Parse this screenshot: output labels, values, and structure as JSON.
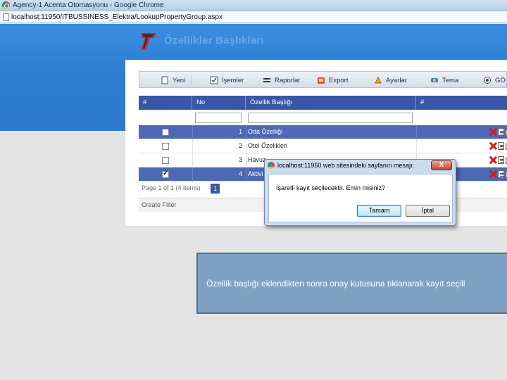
{
  "browser": {
    "window_title": "Agency-1 Acenta Otomasyonu - Google Chrome",
    "url": "localhost:11950/ITBUSSINESS_Elektra/LookupPropertyGroup.aspx"
  },
  "page": {
    "title": "Özellikler Başlıkları"
  },
  "toolbar": {
    "items": [
      {
        "label": "Yeni",
        "icon": "new-document-icon"
      },
      {
        "label": "İşemler",
        "icon": "checklist-icon"
      },
      {
        "label": "Raporlar",
        "icon": "report-icon"
      },
      {
        "label": "Export",
        "icon": "export-icon"
      },
      {
        "label": "Ayarlar",
        "icon": "settings-icon"
      },
      {
        "label": "Tema",
        "icon": "theme-icon"
      },
      {
        "label": "GÖ",
        "icon": "view-icon"
      }
    ]
  },
  "grid": {
    "columns": [
      "#",
      "No",
      "Özellik Başlığı",
      "#"
    ],
    "rows": [
      {
        "no": "1",
        "name": "Oda Özelliği",
        "checked": false,
        "selected": true
      },
      {
        "no": "2",
        "name": "Otel Özelikleri",
        "checked": false,
        "selected": false
      },
      {
        "no": "3",
        "name": "Havuz",
        "checked": false,
        "selected": false
      },
      {
        "no": "4",
        "name": "Aktivi",
        "checked": true,
        "selected": true
      }
    ],
    "pager_text": "Page 1 of 1 (4 items)",
    "current_page": "1",
    "create_filter": "Create Filter"
  },
  "dialog": {
    "title": "localhost:11950 web sitesindeki sayfanın mesajı:",
    "close_label": "X",
    "message": "İşaretli kayıt seçilecektir. Emin misiniz?",
    "ok_label": "Tamam",
    "cancel_label": "İptal"
  },
  "caption": {
    "text": "Özellik başlığı eklendikten sonra onay kutusuna tıklanarak kayıt seçili"
  },
  "colors": {
    "header_blue": "#2f7fd5",
    "grid_header": "#3a56a6",
    "selected_row": "#4d68b5",
    "caption_bg": "#7fa2c4"
  }
}
